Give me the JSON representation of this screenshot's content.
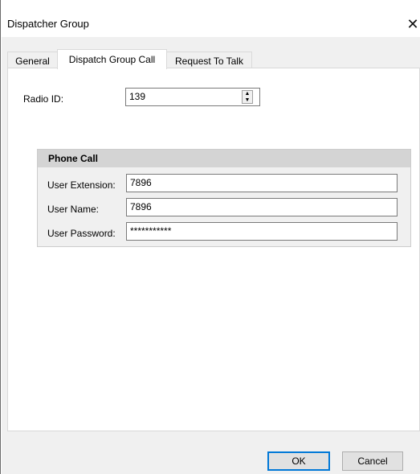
{
  "window": {
    "title": "Dispatcher Group",
    "close_glyph": "✕"
  },
  "tabs": [
    {
      "label": "General",
      "active": false
    },
    {
      "label": "Dispatch Group Call",
      "active": true
    },
    {
      "label": "Request To Talk",
      "active": false
    }
  ],
  "radio_id": {
    "label": "Radio ID:",
    "value": "139",
    "spinner_up": "▲",
    "spinner_down": "▼"
  },
  "phone_call": {
    "title": "Phone Call",
    "user_extension_label": "User Extension:",
    "user_extension_value": "7896",
    "user_name_label": "User Name:",
    "user_name_value": "7896",
    "user_password_label": "User Password:",
    "user_password_value": "***********"
  },
  "buttons": {
    "ok_label": "OK",
    "cancel_label": "Cancel"
  },
  "colors": {
    "accent": "#0078d7",
    "group_header": "#d4d4d4",
    "client_bg": "#f0f0f0"
  }
}
